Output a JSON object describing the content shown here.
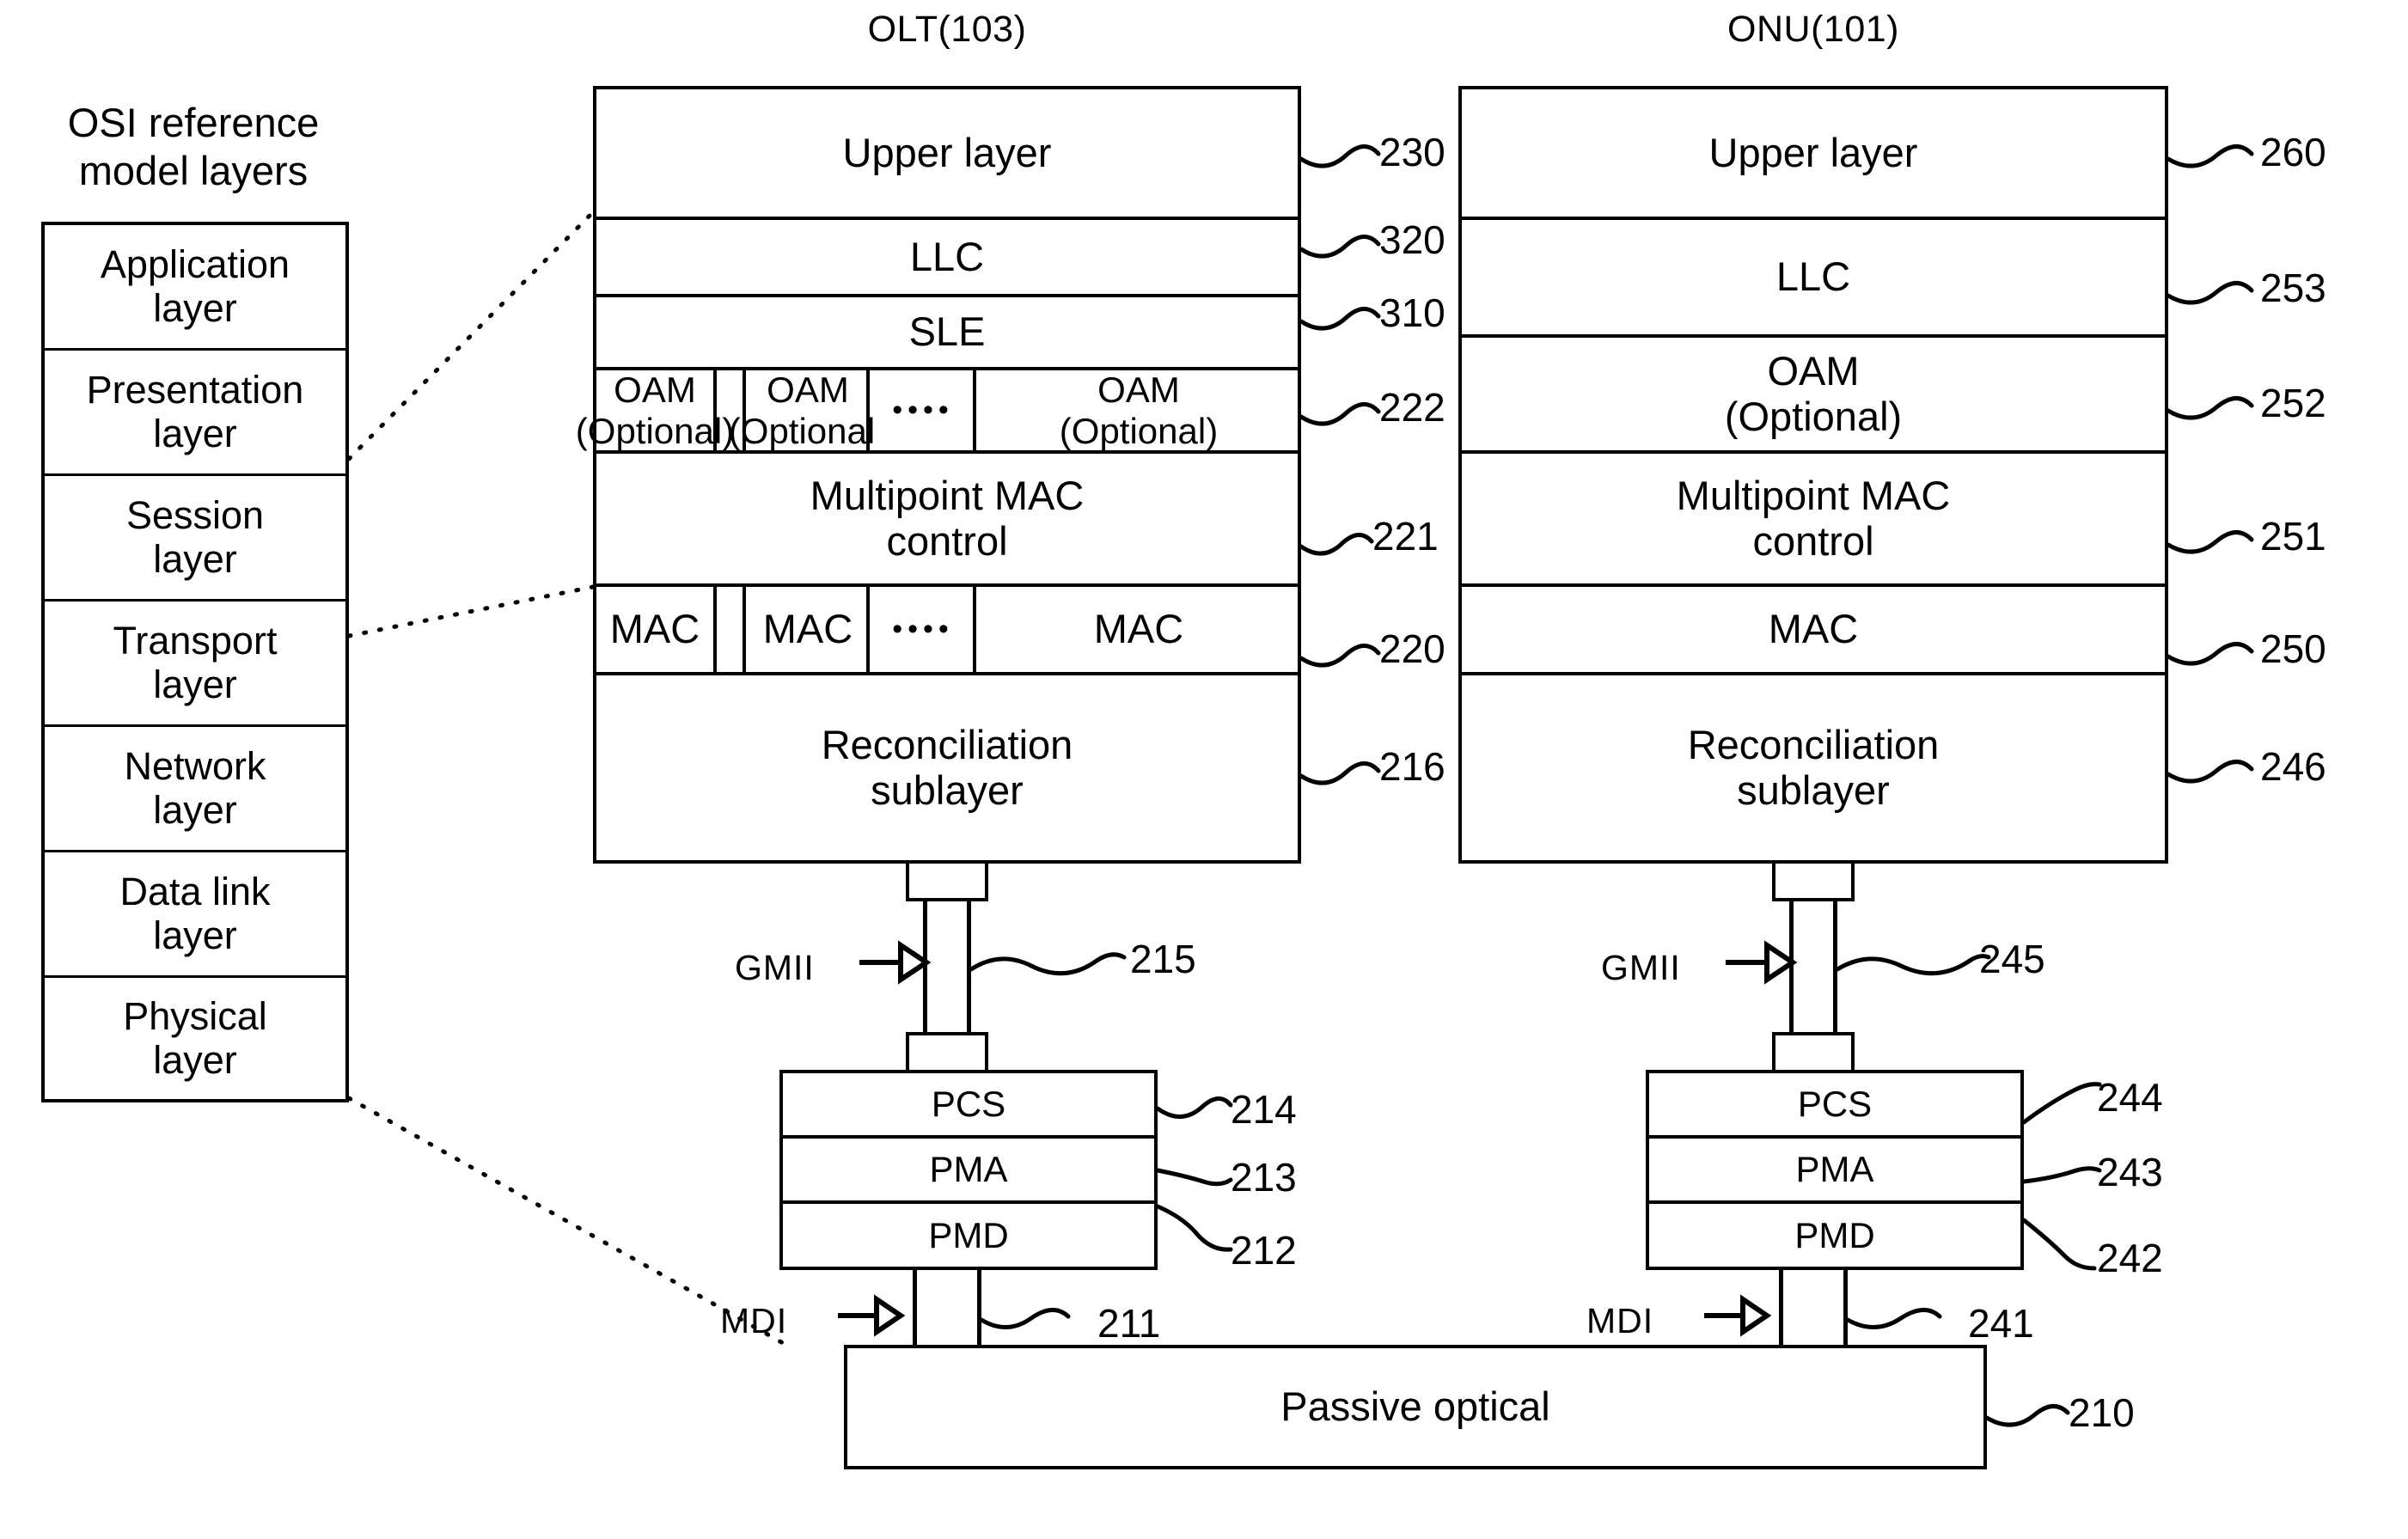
{
  "osi": {
    "heading_line1": "OSI reference",
    "heading_line2": "model layers",
    "layers": [
      {
        "line1": "Application",
        "line2": "layer"
      },
      {
        "line1": "Presentation",
        "line2": "layer"
      },
      {
        "line1": "Session",
        "line2": "layer"
      },
      {
        "line1": "Transport",
        "line2": "layer"
      },
      {
        "line1": "Network",
        "line2": "layer"
      },
      {
        "line1": "Data link",
        "line2": "layer"
      },
      {
        "line1": "Physical",
        "line2": "layer"
      }
    ]
  },
  "olt": {
    "title": "OLT(103)",
    "rows": {
      "upper_layer": "Upper layer",
      "llc": "LLC",
      "sle": "SLE",
      "oam_line1": "OAM",
      "oam_line2": "(Optional)",
      "mpmc_line1": "Multipoint MAC",
      "mpmc_line2": "control",
      "mac": "MAC",
      "recon_line1": "Reconciliation",
      "recon_line2": "sublayer",
      "pcs": "PCS",
      "pma": "PMA",
      "pmd": "PMD",
      "ellipsis": "••••"
    },
    "signals": {
      "gmii": "GMII",
      "mdi": "MDI"
    },
    "refs": {
      "upper_layer": "230",
      "llc": "320",
      "sle": "310",
      "oam": "222",
      "mpmc": "221",
      "mac": "220",
      "recon": "216",
      "gmii": "215",
      "pcs": "214",
      "pma": "213",
      "pmd": "212",
      "mdi": "211"
    }
  },
  "onu": {
    "title": "ONU(101)",
    "rows": {
      "upper_layer": "Upper layer",
      "llc": "LLC",
      "oam_line1": "OAM",
      "oam_line2": "(Optional)",
      "mpmc_line1": "Multipoint MAC",
      "mpmc_line2": "control",
      "mac": "MAC",
      "recon_line1": "Reconciliation",
      "recon_line2": "sublayer",
      "pcs": "PCS",
      "pma": "PMA",
      "pmd": "PMD"
    },
    "signals": {
      "gmii": "GMII",
      "mdi": "MDI"
    },
    "refs": {
      "upper_layer": "260",
      "llc": "253",
      "oam": "252",
      "mpmc": "251",
      "mac": "250",
      "recon": "246",
      "gmii": "245",
      "pcs": "244",
      "pma": "243",
      "pmd": "242",
      "mdi": "241"
    }
  },
  "bottom": {
    "label": "Passive optical",
    "ref": "210"
  },
  "colors": {
    "ink": "#000000",
    "paper": "#ffffff"
  }
}
